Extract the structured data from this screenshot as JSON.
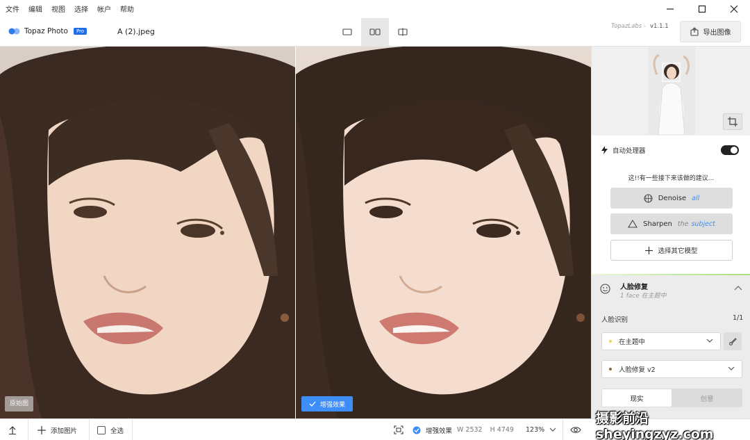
{
  "menu": {
    "items": [
      "文件",
      "编辑",
      "视图",
      "选择",
      "帐户",
      "帮助"
    ]
  },
  "window_controls": [
    "minimize-icon",
    "maximize-icon",
    "close-icon"
  ],
  "toolbar": {
    "app_name": "Topaz Photo",
    "pro_badge": "Pro",
    "file_name": "A (2).jpeg",
    "view_modes": [
      "single-view",
      "side-by-side",
      "split-view"
    ],
    "active_view_mode": "side-by-side",
    "brand_text": "TopazLabs -",
    "version": "v1.1.1",
    "export_label": "导出图像"
  },
  "preview": {
    "original_label": "原始图",
    "enhanced_label": "增强效果"
  },
  "panel": {
    "autopilot_label": "自动处理器",
    "autopilot_on": true,
    "suggestion_text": "这!!有一些接下来该做的建议...",
    "denoise": {
      "label": "Denoise",
      "qualifier": "all"
    },
    "sharpen": {
      "label": "Sharpen",
      "dim": "the",
      "qualifier": "subject"
    },
    "other_models_label": "选择其它模型",
    "face_recovery": {
      "title": "人脸修复",
      "subtitle": "1 face 在主题中",
      "detect_label": "人脸识别",
      "detect_count": "1/1",
      "subject_select": "在主题中",
      "model_select": "人脸修复 v2",
      "tab_realistic": "现实",
      "tab_creative": "创意"
    },
    "accent_color": "#3e8ef7"
  },
  "bottombar": {
    "add_image_label": "添加图片",
    "select_all_label": "全选",
    "enhanced_label": "增强效果",
    "width_label": "W 2532",
    "height_label": "H 4749",
    "zoom": "123%"
  },
  "watermark": "摄影前沿 sheyingzyz.com"
}
